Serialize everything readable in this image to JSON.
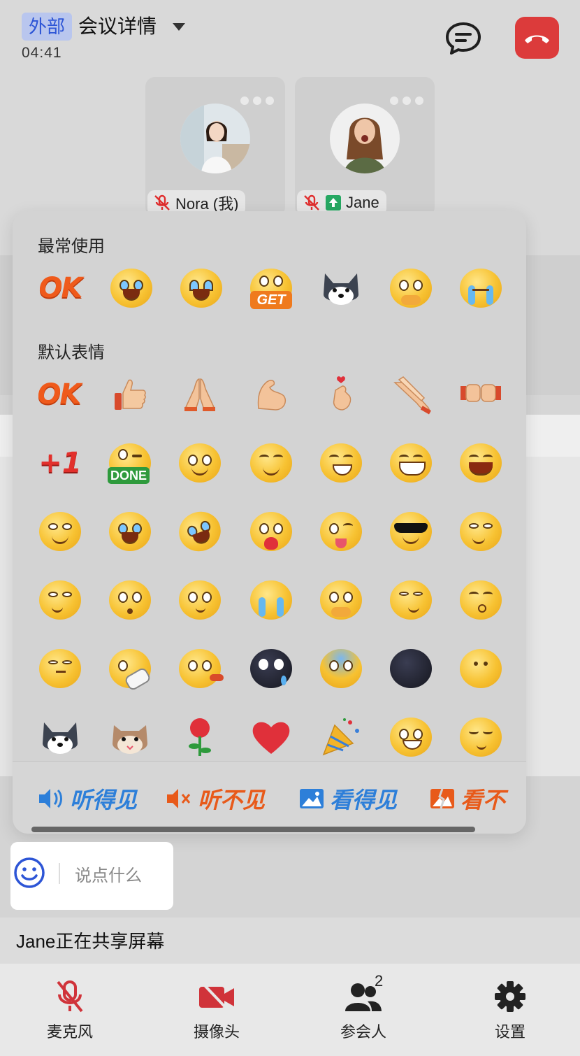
{
  "header": {
    "tag": "外部",
    "title": "会议详情",
    "timer": "04:41"
  },
  "participants": [
    {
      "name": "Nora (我)",
      "muted": true,
      "sharing": false
    },
    {
      "name": "Jane",
      "muted": true,
      "sharing": true
    }
  ],
  "emoji_panel": {
    "frequent_title": "最常使用",
    "frequent": [
      "ok-text",
      "rofl",
      "joy",
      "get-badge",
      "husky",
      "touched",
      "crying"
    ],
    "default_title": "默认表情",
    "default_rows": [
      [
        "ok-text",
        "thumbs-up",
        "pray",
        "muscle",
        "finger-heart",
        "clap",
        "fist-bump"
      ],
      [
        "plus-one",
        "done-badge",
        "smile-eyes",
        "smile",
        "grin",
        "big-grin",
        "laugh"
      ],
      [
        "blush-smile",
        "joy",
        "rofl",
        "heart-hug",
        "tongue-wink",
        "sunglasses",
        "smirk-sparkle"
      ],
      [
        "thinking-smirk",
        "drool",
        "think",
        "crying",
        "touched",
        "smirk",
        "kiss"
      ],
      [
        "annoyed",
        "facepalm-shoe",
        "vomit",
        "black-cry",
        "sweat-cool",
        "dark-ball",
        "moon-smile"
      ],
      [
        "husky",
        "cat",
        "rose",
        "heart",
        "party-popper",
        "grin-teeth",
        "shy"
      ]
    ],
    "stickers": [
      "听得见",
      "听不见",
      "看得见",
      "看不"
    ],
    "colors": {
      "blue": "#2d7fd9",
      "orange": "#e85a1a"
    }
  },
  "composer": {
    "placeholder": "说点什么"
  },
  "status": "Jane正在共享屏幕",
  "toolbar": {
    "mic": "麦克风",
    "camera": "摄像头",
    "participants": "参会人",
    "participants_count": "2",
    "settings": "设置"
  }
}
